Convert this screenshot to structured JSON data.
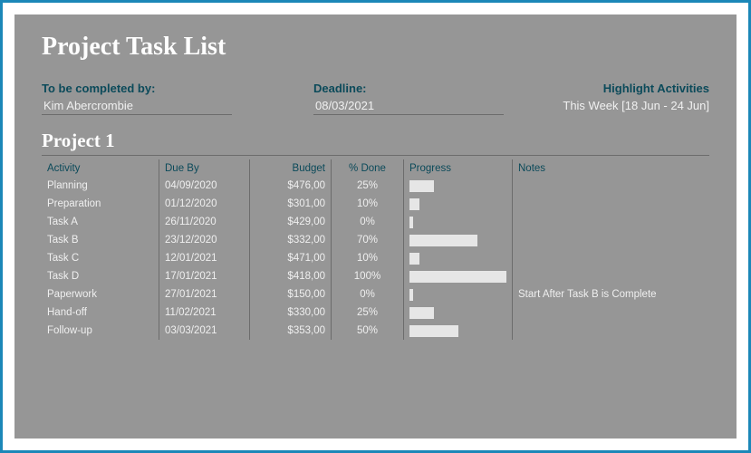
{
  "title": "Project Task List",
  "headline": {
    "completed_by_label": "To be completed by:",
    "completed_by_value": "Kim Abercrombie",
    "deadline_label": "Deadline:",
    "deadline_value": "08/03/2021",
    "highlight_label": "Highlight Activities",
    "highlight_value": "This Week [18 Jun - 24 Jun]"
  },
  "project_heading": "Project 1",
  "columns": {
    "activity": "Activity",
    "due_by": "Due By",
    "budget": "Budget",
    "pct_done": "% Done",
    "progress": "Progress",
    "notes": "Notes"
  },
  "rows": [
    {
      "activity": "Planning",
      "due_by": "04/09/2020",
      "budget": "$476,00",
      "pct_done": "25%",
      "progress_pct": 25,
      "notes": ""
    },
    {
      "activity": "Preparation",
      "due_by": "01/12/2020",
      "budget": "$301,00",
      "pct_done": "10%",
      "progress_pct": 10,
      "notes": ""
    },
    {
      "activity": "Task A",
      "due_by": "26/11/2020",
      "budget": "$429,00",
      "pct_done": "0%",
      "progress_pct": 4,
      "notes": ""
    },
    {
      "activity": "Task B",
      "due_by": "23/12/2020",
      "budget": "$332,00",
      "pct_done": "70%",
      "progress_pct": 70,
      "notes": ""
    },
    {
      "activity": "Task C",
      "due_by": "12/01/2021",
      "budget": "$471,00",
      "pct_done": "10%",
      "progress_pct": 10,
      "notes": ""
    },
    {
      "activity": "Task D",
      "due_by": "17/01/2021",
      "budget": "$418,00",
      "pct_done": "100%",
      "progress_pct": 100,
      "notes": ""
    },
    {
      "activity": "Paperwork",
      "due_by": "27/01/2021",
      "budget": "$150,00",
      "pct_done": "0%",
      "progress_pct": 4,
      "notes": "Start After Task B is Complete"
    },
    {
      "activity": "Hand-off",
      "due_by": "11/02/2021",
      "budget": "$330,00",
      "pct_done": "25%",
      "progress_pct": 25,
      "notes": ""
    },
    {
      "activity": "Follow-up",
      "due_by": "03/03/2021",
      "budget": "$353,00",
      "pct_done": "50%",
      "progress_pct": 50,
      "notes": ""
    }
  ]
}
